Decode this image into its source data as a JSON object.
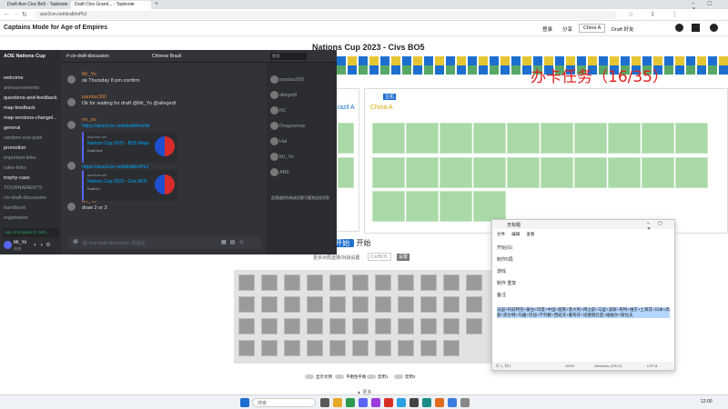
{
  "browser": {
    "tabs": [
      "Draft Aoe Civs Bo5 - Tasknote",
      "Draft Civs Grand... - Tasknote"
    ],
    "url": "aoe2cm.net/draft/mPkJ",
    "top_right": [
      "登录",
      "分享",
      "China A",
      "Draft 好友"
    ]
  },
  "site": {
    "title": "Captains Mode for Age of Empires"
  },
  "draft": {
    "title": "Nations Cup 2023 - Civs BO5",
    "left_team": "Brazil A",
    "right_team": "China A",
    "host_label": "主机",
    "colors": {
      "pick": "#a9d9a6",
      "ban": "#1d6fcf",
      "accent": "#e5c632"
    }
  },
  "task_overlay": {
    "text": "办卡任务（16/35）"
  },
  "start": {
    "prefix": "按下",
    "button": "开始",
    "suffix": "开始"
  },
  "filter": {
    "label": "更多对局选择/对战设置",
    "value": "Civ/BO5",
    "button": "设置"
  },
  "toggles": [
    "显示文明",
    "平衡性平衡",
    "禁用1",
    "禁用2"
  ],
  "footer_arrow": "▲ 更多",
  "discord": {
    "server": "AOE Nations Cup",
    "channels": [
      {
        "name": "welcome",
        "bright": true
      },
      {
        "name": "announcements",
        "bright": false
      },
      {
        "name": "questions-and-feedback",
        "bright": true
      },
      {
        "name": "map-feedback",
        "bright": true
      },
      {
        "name": "map-versions-changel...",
        "bright": true
      },
      {
        "name": "general",
        "bright": true
      },
      {
        "name": "random-civs-pool",
        "bright": false
      },
      {
        "name": "promotion",
        "bright": true
      },
      {
        "name": "important-links",
        "bright": false
      },
      {
        "name": "rules-links",
        "bright": false
      },
      {
        "name": "trophy-case",
        "bright": true
      },
      {
        "name": "TOURNAMENTS",
        "bright": false
      },
      {
        "name": "civ-draft-discussion",
        "bright": false
      },
      {
        "name": "handbook",
        "bright": false
      },
      {
        "name": "registration",
        "bright": false
      }
    ],
    "voice_banner": "Age of Empires II: Defi...",
    "user": {
      "name": "Mr_Yo",
      "status": "在线"
    },
    "channel_header": "# civ-draft-discussion",
    "thread_tab": "Chinese Brazil",
    "search_placeholder": "搜索",
    "messages": [
      {
        "user": "Mr_Yo",
        "text": "ok Thursday 8 pm confirm"
      },
      {
        "user": "pandaz300",
        "text": "Ok for waiting for draft @Mr_Yo @allegedl"
      },
      {
        "user": "mr_oo",
        "text": "https://aoe2cm.net/draft/hmrhk"
      },
      {
        "user": "",
        "text": "https://aoe2cm.net/draft/mPkJ"
      },
      {
        "user": "Mr_Yo",
        "text": "draw 2 or 3"
      }
    ],
    "embeds": [
      {
        "site": "aoe2cm.net",
        "title": "Nations Cup 2023 - BO5 Maps",
        "desc": "Draft Aoe"
      },
      {
        "site": "aoe2cm.net",
        "title": "Nations Cup 2023 - Civs BO5",
        "desc": "Draft A+"
      }
    ],
    "input_placeholder": "给 #civ-draft-discussion 发消息",
    "members": [
      "pandaz300",
      "allegedl",
      "fit1",
      "Dragonmoe",
      "Hal",
      "Mr_Yo",
      "ABE"
    ],
    "member_note": "此频道的所有成员都可看到这些消息"
  },
  "notepad": {
    "title": "无标题",
    "menu": [
      "文件",
      "编辑",
      "查看"
    ],
    "lines": [
      "开始(G)",
      "制作5局",
      "游戏",
      "制作 重复",
      "备注"
    ],
    "highlight": "法国+阿兹特克+蒙古+印度+中国+越南+意大利+拜占庭+马里+波斯+哥特+维京+土耳其+日本+高丽+凯尔特+玛雅+印加+不列颠+西班牙+葡萄牙+埃塞俄比亚+柏柏尔+斯拉夫",
    "status": [
      "行 1, 列 1",
      "100%",
      "Windows (CRLF)",
      "UTF-8"
    ]
  },
  "taskbar": {
    "search_placeholder": "搜索",
    "clock": "12:00"
  }
}
